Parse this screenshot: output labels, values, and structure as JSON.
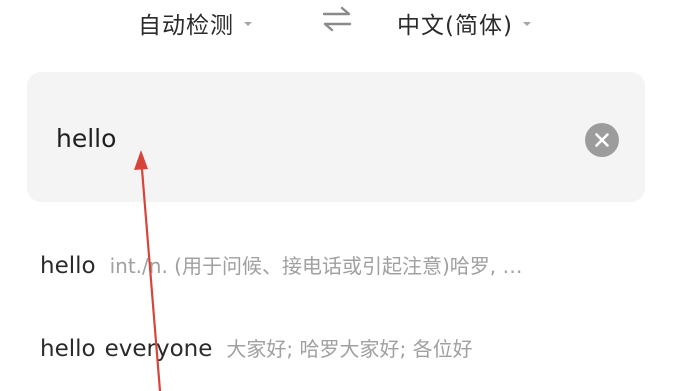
{
  "language_bar": {
    "source_language": "自动检测",
    "target_language": "中文(简体)",
    "swap_icon": "swap-arrows-icon",
    "dropdown_icon": "caret-down-icon"
  },
  "input": {
    "value": "hello",
    "clear_icon": "clear-circle-icon"
  },
  "suggestions": [
    {
      "word_parts": [
        "hello"
      ],
      "definition": "int./n. (用于问候、接电话或引起注意)哈罗, …"
    },
    {
      "word_parts": [
        "hello",
        "everyone"
      ],
      "definition": "大家好; 哈罗大家好; 各位好"
    }
  ],
  "annotation": {
    "color": "#d9443a"
  }
}
